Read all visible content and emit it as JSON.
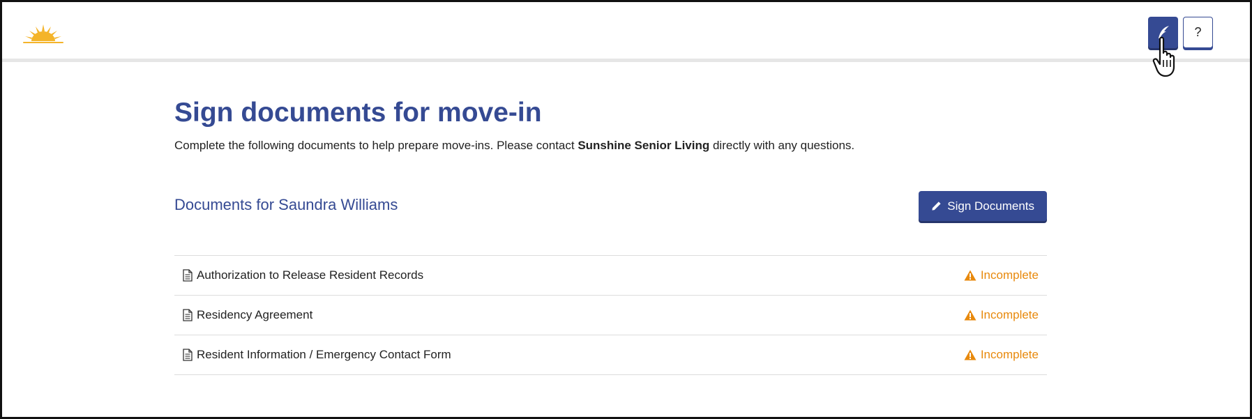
{
  "brand": {
    "logo_icon": "sun-logo-icon",
    "accent_color": "#354a93",
    "warning_color": "#e8890c"
  },
  "toolbar": {
    "sign_icon": "quill-icon",
    "help_label": "?"
  },
  "page": {
    "title": "Sign documents for move-in",
    "intro_prefix": "Complete the following documents to help prepare move-ins. Please contact ",
    "intro_org": "Sunshine Senior Living",
    "intro_suffix": " directly with any questions."
  },
  "documents": {
    "heading": "Documents for Saundra Williams",
    "sign_button_label": "Sign Documents",
    "items": [
      {
        "name": "Authorization to Release Resident Records",
        "status": "Incomplete"
      },
      {
        "name": "Residency Agreement",
        "status": "Incomplete"
      },
      {
        "name": "Resident Information / Emergency Contact Form",
        "status": "Incomplete"
      }
    ]
  }
}
